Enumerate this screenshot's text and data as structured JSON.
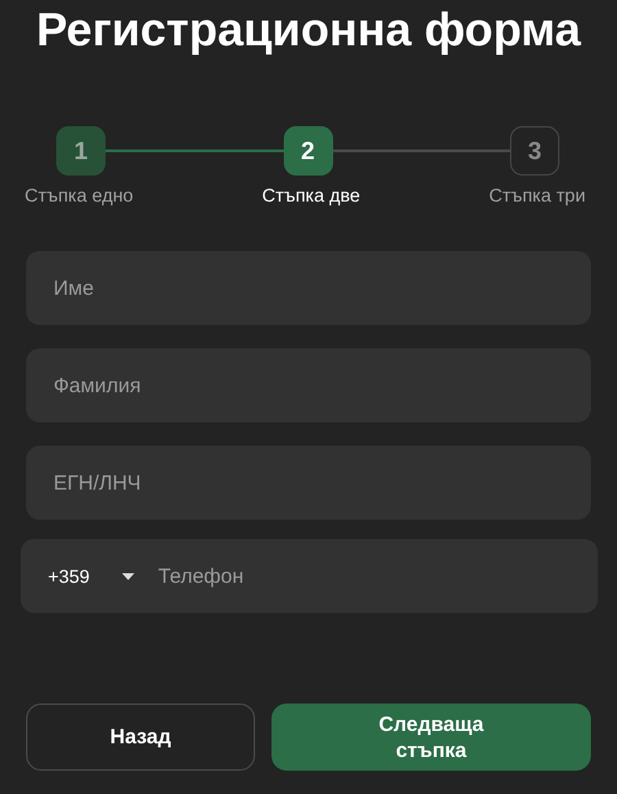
{
  "title": "Регистрационна форма",
  "steps": [
    {
      "number": "1",
      "label": "Стъпка едно",
      "completed": true,
      "selected": false
    },
    {
      "number": "2",
      "label": "Стъпка две",
      "completed": false,
      "selected": true
    },
    {
      "number": "3",
      "label": "Стъпка три",
      "completed": false,
      "selected": false
    }
  ],
  "fields": [
    {
      "placeholder": "Име"
    },
    {
      "placeholder": "Фамилия"
    },
    {
      "placeholder": "ЕГН/ЛНЧ"
    }
  ],
  "phone": {
    "country_code": "+359",
    "placeholder": "Телефон"
  },
  "buttons": [
    {
      "label": "Назад",
      "kind": "secondary"
    },
    {
      "label": "Следваща стъпка",
      "kind": "primary"
    }
  ]
}
